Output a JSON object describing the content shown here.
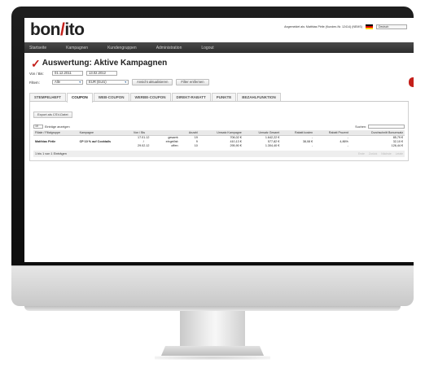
{
  "app": {
    "logo_left": "bon",
    "logo_slash": "/",
    "logo_right": "ito"
  },
  "userbar": {
    "text": "Angemeldet als: Matthias Pirtle (Kunden-Nr. 12414) (NEMS)",
    "language": "Deutsch",
    "flag_icon": "german-flag-icon"
  },
  "nav": {
    "items": [
      "Startseite",
      "Kampagnen",
      "Kundengruppen",
      "Administration",
      "Logout"
    ]
  },
  "page": {
    "title": "Auswertung: Aktive Kampagnen",
    "check_icon": "checkmark-icon",
    "accent_color": "#c41f1a"
  },
  "filters": {
    "date_label": "Von / Bis:",
    "date_from": "01.12.2011",
    "date_to": "13.02.2012",
    "filter_label": "Filtern:",
    "group_value": "Alle",
    "currency_value": "EUR (Euro)",
    "refresh_button": "Ansicht aktualisieren",
    "remove_filter_button": "Filter entfernen"
  },
  "tabs": [
    "STEMPELHEFT",
    "COUPON",
    "WEB-COUPON",
    "WERBE-COUPON",
    "DIREKT-RABATT",
    "PUNKTE",
    "BEZAHLFUNKTION"
  ],
  "active_tab": "COUPON",
  "panel": {
    "export_button": "Export als CSV-Datei",
    "entries_count": "10",
    "entries_label": "Einträge anzeigen",
    "search_label": "Suchen:"
  },
  "table": {
    "headers": [
      "Filiale / Filialgruppe",
      "Kampagne",
      "Von / Bis",
      "",
      "Anzahl",
      "Umsatz Kampagne",
      "Umsatz Gesamt",
      "Rabatt kosten",
      "Rabatt Prozent",
      "Durchschnitt Bonumsatz"
    ],
    "row": {
      "branch": "Matthias Pirtle",
      "campaign": "CP 10 % auf Cocktails",
      "dates": [
        "17.01.12",
        "/",
        "29.02.12"
      ],
      "labels": [
        "gesamt:",
        "eingelöst:",
        "offen:"
      ],
      "counts": [
        "19",
        "9",
        "10"
      ],
      "revenue_campaign": [
        "706,02 €",
        "410,13 €",
        "295,90 €"
      ],
      "revenue_total": [
        "1.642,22 €",
        "577,82 €",
        "1.304,40 €"
      ],
      "discount_cost": [
        "-",
        "38,08 €",
        "-"
      ],
      "discount_percent": [
        "-",
        "4,86%",
        "-"
      ],
      "avg_receipt": [
        "85,79 €",
        "32,10 €",
        "126,44 €"
      ]
    }
  },
  "footer": {
    "info": "1 bis 1 von 1 Einträgen",
    "pager": [
      "Erste",
      "Zurück",
      "Nächste",
      "Letzte"
    ]
  }
}
